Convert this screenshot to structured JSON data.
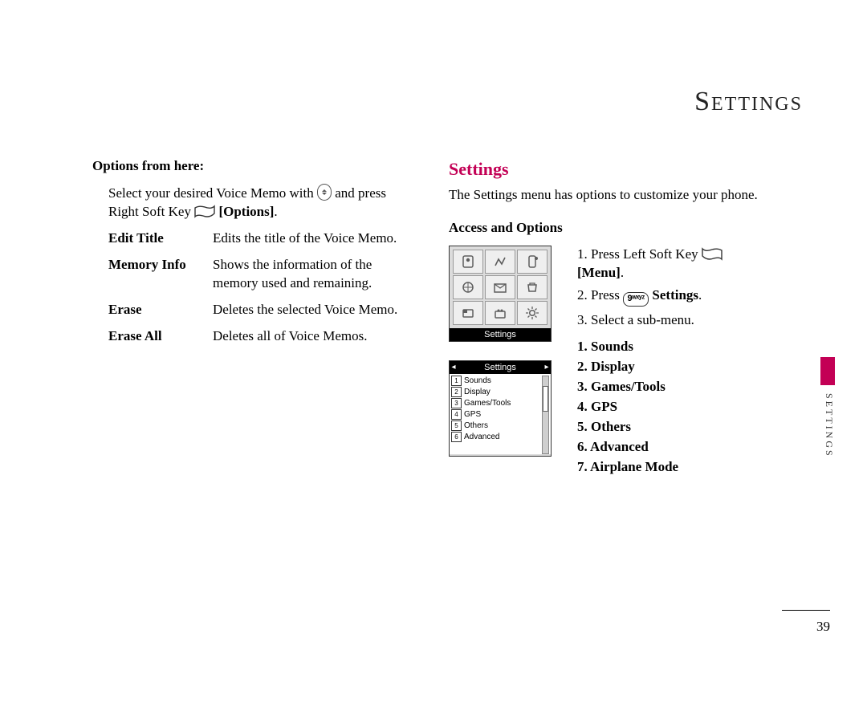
{
  "chapter_title": "Settings",
  "left": {
    "options_from_here": "Options from here:",
    "intro_a": "Select your desired Voice Memo with ",
    "intro_b": " and press Right Soft Key ",
    "intro_options_label": "[Options]",
    "intro_c": ".",
    "defs": [
      {
        "term": "Edit Title",
        "desc": "Edits the title of the Voice Memo."
      },
      {
        "term": "Memory Info",
        "desc": "Shows the information of the memory used and remaining."
      },
      {
        "term": "Erase",
        "desc": "Deletes the selected Voice Memo."
      },
      {
        "term": "Erase All",
        "desc": "Deletes all of Voice Memos."
      }
    ]
  },
  "right": {
    "heading": "Settings",
    "settings_desc": "The Settings menu has options to customize your phone.",
    "access_heading": "Access and Options",
    "step1_a": "1. Press Left Soft Key ",
    "step1_menu": "[Menu]",
    "step1_b": ".",
    "step2_a": "2. Press  ",
    "key9_label": "9ʷˣʸᶻ",
    "step2_b": "  ",
    "step2_settings": "Settings",
    "step2_c": ".",
    "step3": "3. Select a sub-menu.",
    "submenu": [
      "1. Sounds",
      "2. Display",
      "3. Games/Tools",
      "4. GPS",
      "5. Others",
      "6. Advanced",
      "7. Airplane Mode"
    ],
    "shot1_footer": "Settings",
    "shot2_title": "Settings",
    "shot2_rows": [
      {
        "n": "1",
        "label": "Sounds"
      },
      {
        "n": "2",
        "label": "Display"
      },
      {
        "n": "3",
        "label": "Games/Tools"
      },
      {
        "n": "4",
        "label": "GPS"
      },
      {
        "n": "5",
        "label": "Others"
      },
      {
        "n": "6",
        "label": "Advanced"
      }
    ]
  },
  "side_label": "SETTINGS",
  "page_number": "39"
}
